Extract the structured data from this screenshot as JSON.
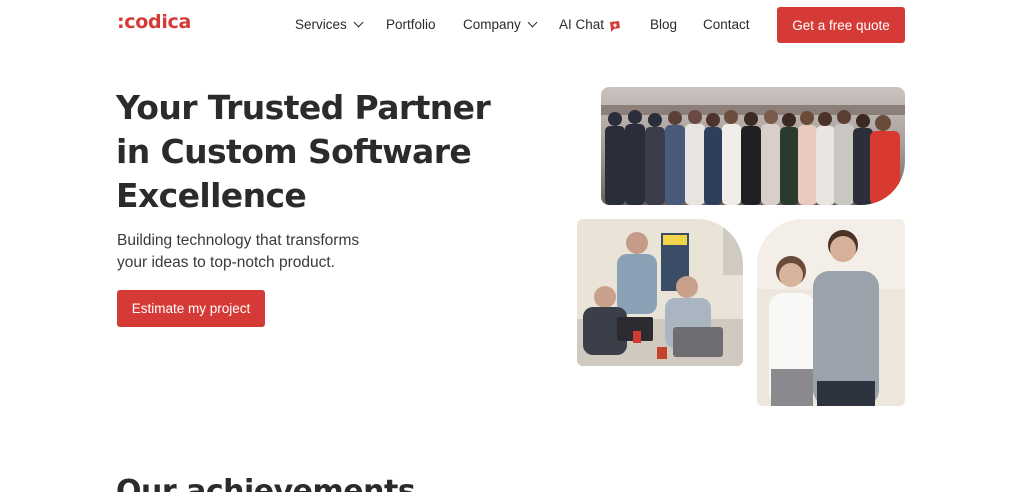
{
  "brand": {
    "logo_text": ":codica",
    "accent_color": "#d63a36"
  },
  "nav": {
    "items": [
      {
        "label": "Services",
        "has_dropdown": true
      },
      {
        "label": "Portfolio",
        "has_dropdown": false
      },
      {
        "label": "Company",
        "has_dropdown": true
      },
      {
        "label": "AI Chat",
        "has_dropdown": false,
        "icon": "ai-chat-badge-icon"
      },
      {
        "label": "Blog",
        "has_dropdown": false
      },
      {
        "label": "Contact",
        "has_dropdown": false
      }
    ],
    "cta_label": "Get a free quote"
  },
  "hero": {
    "title_lines": [
      "Your Trusted Partner",
      "in Custom Software",
      "Excellence"
    ],
    "subtitle_lines": [
      "Building technology that transforms",
      "your ideas to top-notch product."
    ],
    "cta_label": "Estimate my project",
    "images": [
      "team-group-photo",
      "developers-at-desk-photo",
      "founders-portrait-photo"
    ]
  },
  "achievements": {
    "title": "Our achievements"
  }
}
